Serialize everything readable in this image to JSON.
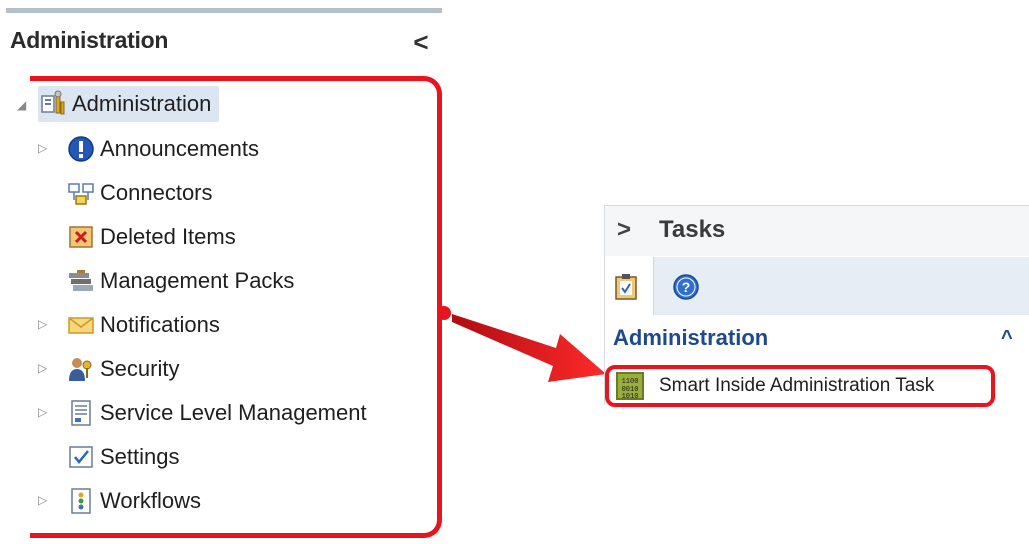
{
  "nav_pane": {
    "title": "Administration",
    "collapse_glyph": "<",
    "tree": {
      "root": {
        "label": "Administration",
        "icon": "admin-tools-icon",
        "expanded": true
      },
      "items": [
        {
          "label": "Announcements",
          "icon": "info-icon",
          "has_children": true
        },
        {
          "label": "Connectors",
          "icon": "connector-icon",
          "has_children": false
        },
        {
          "label": "Deleted Items",
          "icon": "deleted-items-icon",
          "has_children": false
        },
        {
          "label": "Management Packs",
          "icon": "management-packs-icon",
          "has_children": false
        },
        {
          "label": "Notifications",
          "icon": "envelope-icon",
          "has_children": true
        },
        {
          "label": "Security",
          "icon": "security-users-icon",
          "has_children": true
        },
        {
          "label": "Service Level Management",
          "icon": "document-icon",
          "has_children": true
        },
        {
          "label": "Settings",
          "icon": "settings-checkbox-icon",
          "has_children": false
        },
        {
          "label": "Workflows",
          "icon": "workflow-icon",
          "has_children": true
        }
      ]
    }
  },
  "tasks_pane": {
    "title": "Tasks",
    "chevron": ">",
    "section": {
      "title": "Administration",
      "caret": "^"
    },
    "task": {
      "label": "Smart Inside Administration Task",
      "icon": "binary-task-icon"
    }
  },
  "colors": {
    "highlight": "#e8141e",
    "section_title": "#1c4a8c",
    "selected_row": "#dce6f2"
  }
}
